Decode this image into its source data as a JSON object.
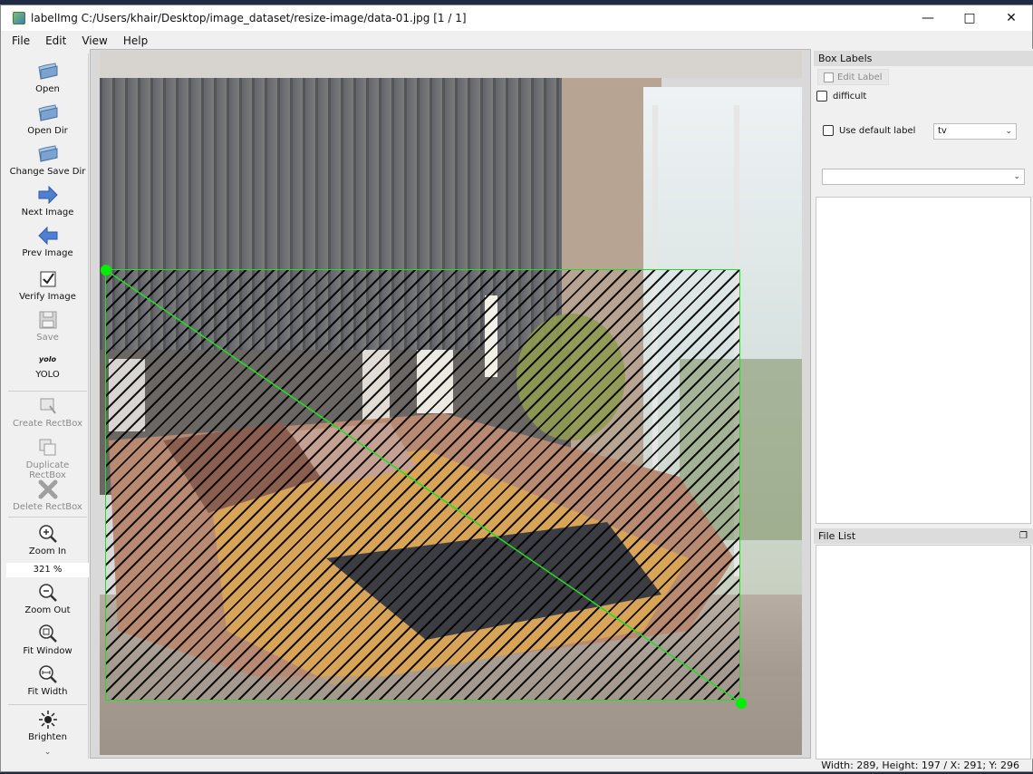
{
  "window": {
    "title": "labelImg C:/Users/khair/Desktop/image_dataset/resize-image/data-01.jpg [1 / 1]"
  },
  "menu": [
    "File",
    "Edit",
    "View",
    "Help"
  ],
  "tools": {
    "open": "Open",
    "open_dir": "Open Dir",
    "change_save_dir": "Change Save Dir",
    "next_image": "Next Image",
    "prev_image": "Prev Image",
    "verify_image": "Verify Image",
    "save": "Save",
    "format_icon_text": "yolo",
    "format": "YOLO",
    "create_rectbox": "Create RectBox",
    "duplicate_rectbox": "Duplicate RectBox",
    "delete_rectbox": "Delete RectBox",
    "zoom_in": "Zoom In",
    "zoom_value": "321 %",
    "zoom_out": "Zoom Out",
    "fit_window": "Fit Window",
    "fit_width": "Fit Width",
    "brighten": "Brighten"
  },
  "box_labels": {
    "title": "Box Labels",
    "edit_label": "Edit Label",
    "difficult": "difficult",
    "use_default_label": "Use default label",
    "default_label_value": "tv",
    "label_combo_value": ""
  },
  "file_list": {
    "title": "File List"
  },
  "status": {
    "text": "Width: 289, Height: 197 / X: 291; Y: 296"
  },
  "colors": {
    "bbox": "#22dd22",
    "handle": "#00ee00"
  }
}
